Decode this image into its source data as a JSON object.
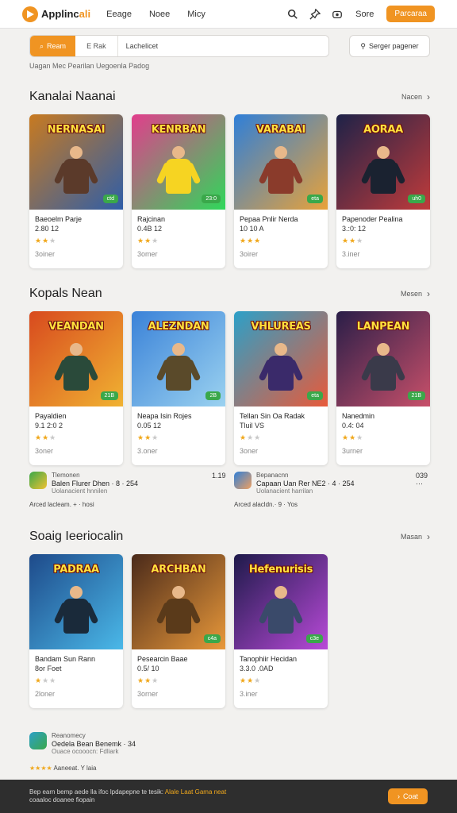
{
  "header": {
    "brand_prefix": "Applinc",
    "brand_suffix": "ali",
    "nav": [
      "Eeage",
      "Noee",
      "Micy"
    ],
    "login": "Sore",
    "cta": "Parcaraa"
  },
  "filter": {
    "active_chip": "Ream",
    "chip2": "E Rak",
    "input_value": "Lachelicet",
    "button": "Serger pagener",
    "note": "Uagan Mec Pearilan Uegoenla Padog"
  },
  "sections": [
    {
      "title": "Kanalai Naanai",
      "more": "Nacen",
      "cards": [
        {
          "art": "NERNASAI",
          "name": "Baeoelm Parje",
          "sub": "2.80 12",
          "stars": 2,
          "meta": "3oiner",
          "badge": "ctd",
          "bg": [
            "#c87a20",
            "#2f5ea8"
          ],
          "hero": "#5b3a2a"
        },
        {
          "art": "KENRBAN",
          "name": "Rajcinan",
          "sub": "0.4B 12",
          "stars": 2,
          "meta": "3omer",
          "badge": "23:0",
          "bg": [
            "#e23d8c",
            "#2fd85a"
          ],
          "hero": "#f6d422"
        },
        {
          "art": "VARABAI",
          "name": "Pepaa Pnlir Nerda",
          "sub": "10 10 A",
          "stars": 3,
          "meta": "3oirer",
          "badge": "eta",
          "bg": [
            "#2f7fd8",
            "#e8a23a"
          ],
          "hero": "#8a3b2b"
        },
        {
          "art": "AORAA",
          "name": "Papenoder Pealina",
          "sub": "3.:0: 12",
          "stars": 2,
          "meta": "3.iner",
          "badge": "uh0",
          "bg": [
            "#1e2248",
            "#c03b3b"
          ],
          "hero": "#1a2230"
        }
      ]
    },
    {
      "title": "Kopals Nean",
      "more": "Mesen",
      "cards": [
        {
          "art": "VEANDAN",
          "name": "Payaldien",
          "sub": "9.1 2:0 2",
          "stars": 2,
          "meta": "3oner",
          "badge": "21B",
          "bg": [
            "#d84a1e",
            "#f0b232"
          ],
          "hero": "#2a4a3a"
        },
        {
          "art": "ALEZNDAN",
          "name": "Neapa Isin Rojes",
          "sub": "0.05 12",
          "stars": 2,
          "meta": "3.oner",
          "badge": "2B",
          "bg": [
            "#3a82d8",
            "#9bd2f0"
          ],
          "hero": "#5a4a2a"
        },
        {
          "art": "VHLUREAS",
          "name": "Tellan Sin Oa Radak",
          "sub": "Tluil VS",
          "stars": 1,
          "meta": "3oner",
          "badge": "eta",
          "bg": [
            "#2ca0c8",
            "#e85a3a"
          ],
          "hero": "#3a2a6a"
        },
        {
          "art": "LANPEAN",
          "name": "Nanedmin",
          "sub": "0.4: 04",
          "stars": 2,
          "meta": "3urner",
          "badge": "21B",
          "bg": [
            "#2a1e48",
            "#c8506a"
          ],
          "hero": "#3a3a4a"
        }
      ]
    },
    {
      "title": "Soaig Ieeriocalin",
      "more": "Masan",
      "cards": [
        {
          "art": "PADRAA",
          "name": "Bandam Sun Rann",
          "sub": "8or Foet",
          "stars": 1,
          "meta": "2loner",
          "badge": "",
          "bg": [
            "#1e4a8a",
            "#4ab8e8"
          ],
          "hero": "#1a2a3a"
        },
        {
          "art": "ARCHBAN",
          "name": "Pesearcin Baae",
          "sub": "0.5/ 10",
          "stars": 2,
          "meta": "3orner",
          "badge": "c4a",
          "bg": [
            "#4a2a1a",
            "#e8983a"
          ],
          "hero": "#5a3a1a"
        },
        {
          "art": "Hefenurisis",
          "name": "Tanophiir Hecidan",
          "sub": "3.3.0 .0AD",
          "stars": 2,
          "meta": "3.iner",
          "badge": "c3e",
          "bg": [
            "#1e1a4a",
            "#b84ad8"
          ],
          "hero": "#3a4a6a"
        }
      ]
    }
  ],
  "ads": [
    {
      "line1": "Tlemonen",
      "line2": "Balen Flurer Dhen · 8 · 254",
      "line3": "Uolanacient hnnilen",
      "num": "1.19",
      "foot": "Arced lacleam. + · hosi",
      "color1": "#3aa84a",
      "color2": "#f0c232"
    },
    {
      "line1": "Bepanacnn",
      "line2": "Capaan Uan Rer NE2 · 4 · 254",
      "line3": "Uolanacient harrilan",
      "num": "039",
      "foot": "Arced alacldn.· 9 · Yos",
      "color1": "#2f7fd8",
      "color2": "#f0a060"
    },
    {
      "line1": "Reanomecy",
      "line2": "Oedela Bean Benemk · 34",
      "line3": "Ouace ocooocn: Fdliark",
      "num": "",
      "foot": "Aaneeat. Y laia",
      "color1": "#2ca0c8",
      "color2": "#3aa84a"
    }
  ],
  "bottom": {
    "line1": "Bep earn bemp aede lla ifoc lpdapepne te tesik:",
    "line1_hl": "Alale Laat Gama neat",
    "line2": "coaaloc doanee fiopain",
    "cta": "Coat"
  }
}
